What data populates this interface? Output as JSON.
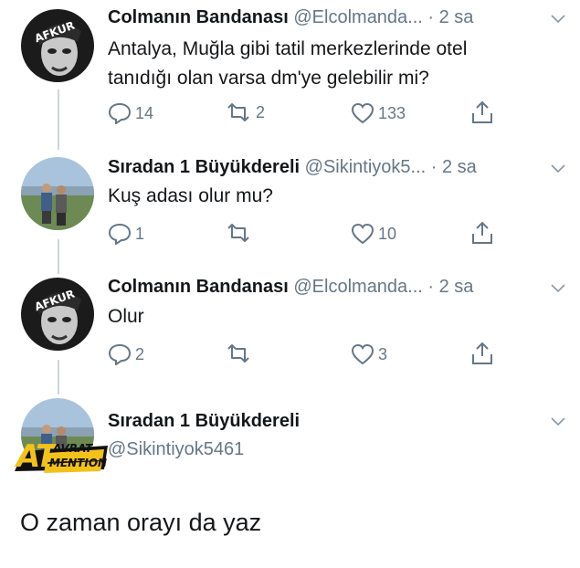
{
  "tweets": [
    {
      "author_name": "Colmanın Bandanası",
      "handle_time": "@Elcolmanda... · 2 sa",
      "text_lines": [
        "Antalya, Muğla gibi tatil merkezlerinde otel",
        "tanıdığı olan varsa dm'ye gelebilir mi?"
      ],
      "reply_count": "14",
      "retweet_count": "2",
      "like_count": "133",
      "avatar_label": "AFKUR"
    },
    {
      "author_name": "Sıradan 1 Büyükdereli",
      "handle_time": "@Sikintiyok5... · 2 sa",
      "text_lines": [
        "Kuş adası olur mu?"
      ],
      "reply_count": "1",
      "retweet_count": "",
      "like_count": "10"
    },
    {
      "author_name": "Colmanın Bandanası",
      "handle_time": "@Elcolmanda... · 2 sa",
      "text_lines": [
        "Olur"
      ],
      "reply_count": "2",
      "retweet_count": "",
      "like_count": "3",
      "avatar_label": "AFKUR"
    }
  ],
  "last_tweet": {
    "author_name": "Sıradan 1 Büyükdereli",
    "handle": "@Sikintiyok5461"
  },
  "standalone_text": "O zaman orayı da yaz",
  "watermark": {
    "big": "AT",
    "top": "AVRAT",
    "bottom": "MENTION"
  },
  "colors": {
    "text": "#14171a",
    "muted": "#657786",
    "thread_line": "#ccd6dd"
  }
}
